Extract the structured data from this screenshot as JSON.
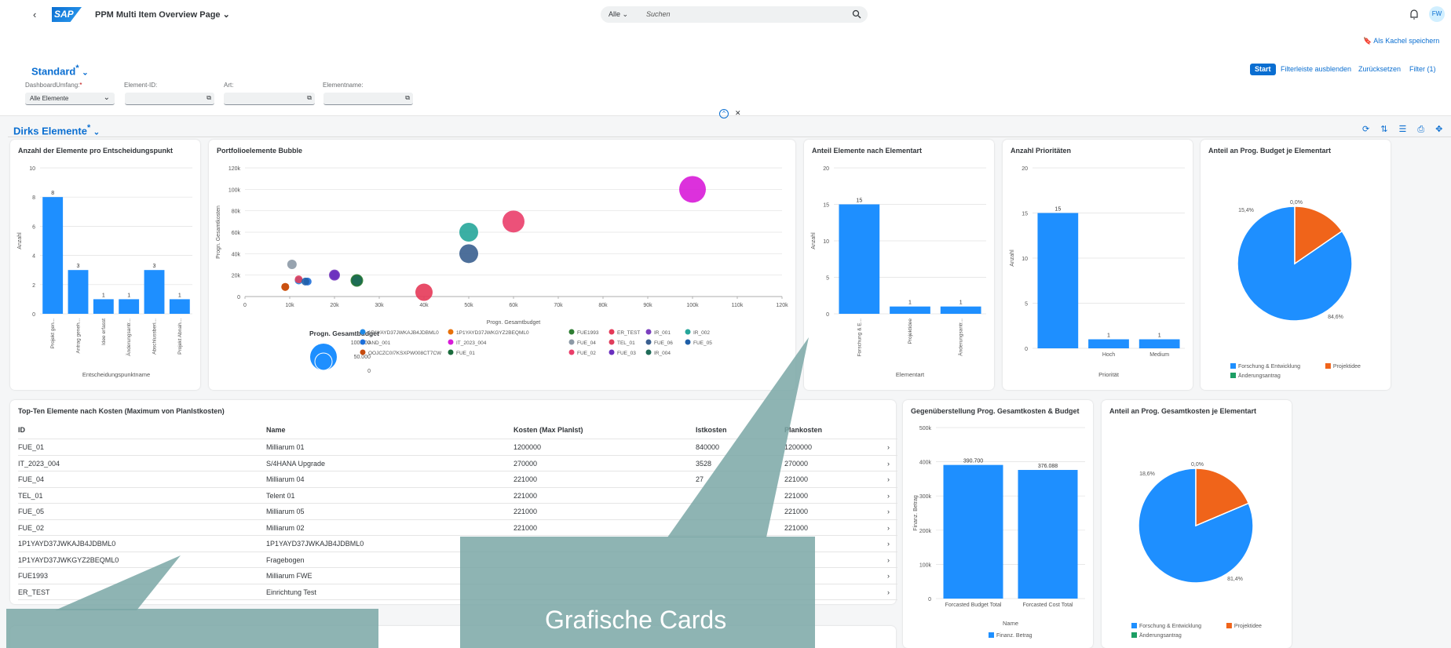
{
  "shell": {
    "title": "PPM Multi Item Overview Page",
    "search_scope": "Alle",
    "search_placeholder": "Suchen",
    "avatar": "FW",
    "back_icon": "chevron-left-icon",
    "notification_icon": "bell-icon",
    "logo": "SAP"
  },
  "header": {
    "save_tile": "Als Kachel speichern",
    "variant": "Standard",
    "variant_marker": "*",
    "filters": [
      {
        "label": "DashboardUmfang:",
        "required": true,
        "value": "Alle Elemente"
      },
      {
        "label": "Element-ID:",
        "value": ""
      },
      {
        "label": "Art:",
        "value": ""
      },
      {
        "label": "Elementname:",
        "value": ""
      }
    ],
    "actions": {
      "start": "Start",
      "hide": "Filterleiste ausblenden",
      "reset": "Zurücksetzen",
      "filter": "Filter (1)"
    }
  },
  "section": {
    "title": "Dirks Elemente",
    "marker": "*"
  },
  "cards": {
    "c1": {
      "title": "Anzahl der Elemente pro Entscheidungspunkt"
    },
    "c2": {
      "title": "Portfolioelemente Bubble"
    },
    "c3": {
      "title": "Anteil Elemente nach Elementart"
    },
    "c4": {
      "title": "Anzahl Prioritäten"
    },
    "c5": {
      "title": "Anteil an Prog. Budget je Elementart"
    },
    "c6": {
      "title": "Gegenüberstellung Prog. Gesamtkosten & Budget"
    },
    "c7": {
      "title": "Anteil an Prog. Gesamtkosten je Elementart"
    }
  },
  "table": {
    "title": "Top-Ten Elemente nach Kosten (Maximum von PlanIstkosten)",
    "columns": [
      "ID",
      "Name",
      "Kosten (Max PlanIst)",
      "Istkosten",
      "Plankosten"
    ],
    "rows": [
      [
        "FUE_01",
        "Milliarum 01",
        "1200000",
        "840000",
        "1200000"
      ],
      [
        "IT_2023_004",
        "S/4HANA Upgrade",
        "270000",
        "3528",
        "270000"
      ],
      [
        "FUE_04",
        "Milliarum 04",
        "221000",
        "27",
        "221000"
      ],
      [
        "TEL_01",
        "Telent 01",
        "221000",
        "",
        "221000"
      ],
      [
        "FUE_05",
        "Milliarum 05",
        "221000",
        "",
        "221000"
      ],
      [
        "FUE_02",
        "Milliarum 02",
        "221000",
        "",
        "221000"
      ],
      [
        "1P1YAYD37JWKAJB4JDBML0",
        "1P1YAYD37JWKAJB4JDBML0",
        "",
        "",
        ""
      ],
      [
        "1P1YAYD37JWKGYZ2BEQML0",
        "Fragebogen",
        "",
        "",
        ""
      ],
      [
        "FUE1993",
        "Milliarum FWE",
        "",
        "",
        ""
      ],
      [
        "ER_TEST",
        "Einrichtung Test",
        "",
        "",
        ""
      ]
    ]
  },
  "callout": {
    "text": "Grafische Cards"
  },
  "chart_data": [
    {
      "type": "bar",
      "categories": [
        "Projekt gen...",
        "Antrag geneh...",
        "Idee erfasst",
        "Änderungsantr...",
        "Abschlussberi...",
        "Projekt Abnah..."
      ],
      "values": [
        8,
        3,
        1,
        1,
        3,
        1
      ],
      "ylabel": "Anzahl",
      "xlabel": "Entscheidungspunktname",
      "ylim": [
        0,
        10
      ],
      "yticks": [
        "0",
        "2",
        "4",
        "6",
        "8",
        "10"
      ]
    },
    {
      "type": "scatter",
      "xlabel": "Progn. Gesamtbudget",
      "ylabel": "Progn. Gesamtkosten",
      "xlim": [
        0,
        120000
      ],
      "ylim": [
        0,
        120000
      ],
      "xticks": [
        "0",
        "10k",
        "20k",
        "30k",
        "40k",
        "50k",
        "60k",
        "70k",
        "80k",
        "90k",
        "100k",
        "110k",
        "120k"
      ],
      "yticks": [
        "0",
        "20k",
        "40k",
        "60k",
        "80k",
        "100k",
        "120k"
      ],
      "legend_title": "Progn. Gesamtbudget",
      "size_legend": [
        "100.000",
        "50.000",
        "0"
      ],
      "series": [
        {
          "name": "1P1YAYD37JWKAJB4JDBML0",
          "color": "#1e88e5",
          "x": 12000,
          "y": 15000,
          "r": 5
        },
        {
          "name": "1P1YAYD37JWKGYZ2BEQML0",
          "color": "#e8710a",
          "x": 9000,
          "y": 9000,
          "r": 5
        },
        {
          "name": "FUE1993",
          "color": "#2e7d32",
          "x": 25000,
          "y": 15000,
          "r": 8
        },
        {
          "name": "ER_TEST",
          "color": "#e53958",
          "x": 40000,
          "y": 4000,
          "r": 11
        },
        {
          "name": "IR_001",
          "color": "#7b3fbe",
          "x": 20000,
          "y": 20000,
          "r": 7
        },
        {
          "name": "IR_002",
          "color": "#26a69a",
          "x": 50000,
          "y": 60000,
          "r": 12
        },
        {
          "name": "AND_001",
          "color": "#1e6fd9",
          "x": 14000,
          "y": 14000,
          "r": 5
        },
        {
          "name": "IT_2023_004",
          "color": "#d81bd8",
          "x": 100000,
          "y": 100000,
          "r": 17
        },
        {
          "name": "FUE_04",
          "color": "#8c99a6",
          "x": 10500,
          "y": 30000,
          "r": 6
        },
        {
          "name": "TEL_01",
          "color": "#e03e5c",
          "x": 12000,
          "y": 16000,
          "r": 5
        },
        {
          "name": "FUE_06",
          "color": "#3a5f8f",
          "x": 50000,
          "y": 40000,
          "r": 12
        },
        {
          "name": "FUE_05",
          "color": "#1f5fa8",
          "x": 13500,
          "y": 14000,
          "r": 5
        },
        {
          "name": "OOJCZC0I7KSXPW008CT7CW",
          "color": "#c74b0e",
          "x": 9000,
          "y": 9000,
          "r": 5
        },
        {
          "name": "FUE_01",
          "color": "#1a6b3c",
          "x": 25000,
          "y": 15000,
          "r": 7
        },
        {
          "name": "FUE_02",
          "color": "#ea3e6a",
          "x": 60000,
          "y": 70000,
          "r": 14
        },
        {
          "name": "FUE_03",
          "color": "#6a2fbf",
          "x": 20000,
          "y": 20000,
          "r": 6
        },
        {
          "name": "IR_004",
          "color": "#1f6b58",
          "x": 25000,
          "y": 15000,
          "r": 6
        }
      ]
    },
    {
      "type": "bar",
      "categories": [
        "Forschung & E...",
        "Projektidee",
        "Änderungsantr..."
      ],
      "values": [
        15,
        1,
        1
      ],
      "ylabel": "Anzahl",
      "xlabel": "Elementart",
      "ylim": [
        0,
        20
      ],
      "yticks": [
        "0",
        "5",
        "10",
        "15",
        "20"
      ]
    },
    {
      "type": "bar",
      "categories": [
        "",
        "Hoch",
        "Medium"
      ],
      "values": [
        15,
        1,
        1
      ],
      "ylabel": "Anzahl",
      "xlabel": "Priorität",
      "ylim": [
        0,
        20
      ],
      "yticks": [
        "0",
        "5",
        "10",
        "15",
        "20"
      ]
    },
    {
      "type": "pie",
      "labels": [
        "Forschung & Entwicklung",
        "Projektidee",
        "Änderungsantrag"
      ],
      "values": [
        84.6,
        15.4,
        0.0
      ],
      "value_labels": [
        "84,6%",
        "15,4%",
        "0,0%"
      ],
      "colors": [
        "#1e8fff",
        "#f0641a",
        "#1c9e64"
      ]
    },
    {
      "type": "bar",
      "categories": [
        "Forcasted Budget Total",
        "Forcasted Cost Total"
      ],
      "values": [
        390700,
        376088
      ],
      "value_labels": [
        "390.700",
        "376.088"
      ],
      "ylabel": "Finanz. Betrag",
      "xlabel": "Name",
      "legend": [
        "Finanz. Betrag"
      ],
      "ylim": [
        0,
        500000
      ],
      "yticks": [
        "0",
        "100k",
        "200k",
        "300k",
        "400k",
        "500k"
      ]
    },
    {
      "type": "pie",
      "labels": [
        "Forschung & Entwicklung",
        "Projektidee",
        "Änderungsantrag"
      ],
      "values": [
        81.4,
        18.6,
        0.0
      ],
      "value_labels": [
        "81,4%",
        "18,6%",
        "0,0%"
      ],
      "colors": [
        "#1e8fff",
        "#f0641a",
        "#1c9e64"
      ]
    }
  ]
}
